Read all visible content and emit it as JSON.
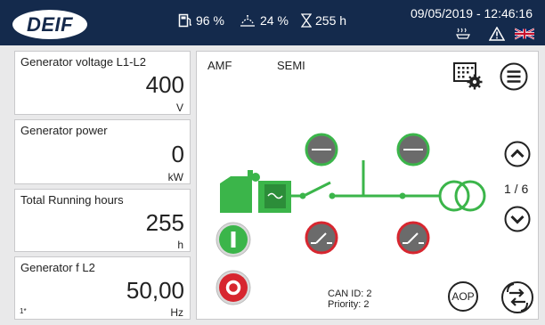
{
  "header": {
    "logo_text": "DEIF",
    "fuel_level": "96 %",
    "def_level": "24 %",
    "service_hours": "255 h",
    "datetime": "09/05/2019 - 12:46:16",
    "icons": [
      "fuel-icon",
      "def-icon",
      "hourglass-icon",
      "horn-icon",
      "alarm-icon",
      "uk-flag-icon"
    ]
  },
  "panels": [
    {
      "label": "Generator voltage L1-L2",
      "value": "400",
      "unit": "V"
    },
    {
      "label": "Generator power",
      "value": "0",
      "unit": "kW"
    },
    {
      "label": "Total Running hours",
      "value": "255",
      "unit": "h"
    },
    {
      "label": "Generator f L2",
      "value": "50,00",
      "unit": "Hz",
      "index": "1*"
    }
  ],
  "main": {
    "mode_amf": "AMF",
    "mode_semi": "SEMI",
    "page_indicator": "1 / 6",
    "can_id": "CAN ID: 2",
    "priority": "Priority: 2",
    "aop_label": "AOP"
  },
  "colors": {
    "header_bg": "#142a4c",
    "green": "#3bb54a",
    "red": "#d7262f",
    "breaker_grey": "#6b6b6b"
  }
}
